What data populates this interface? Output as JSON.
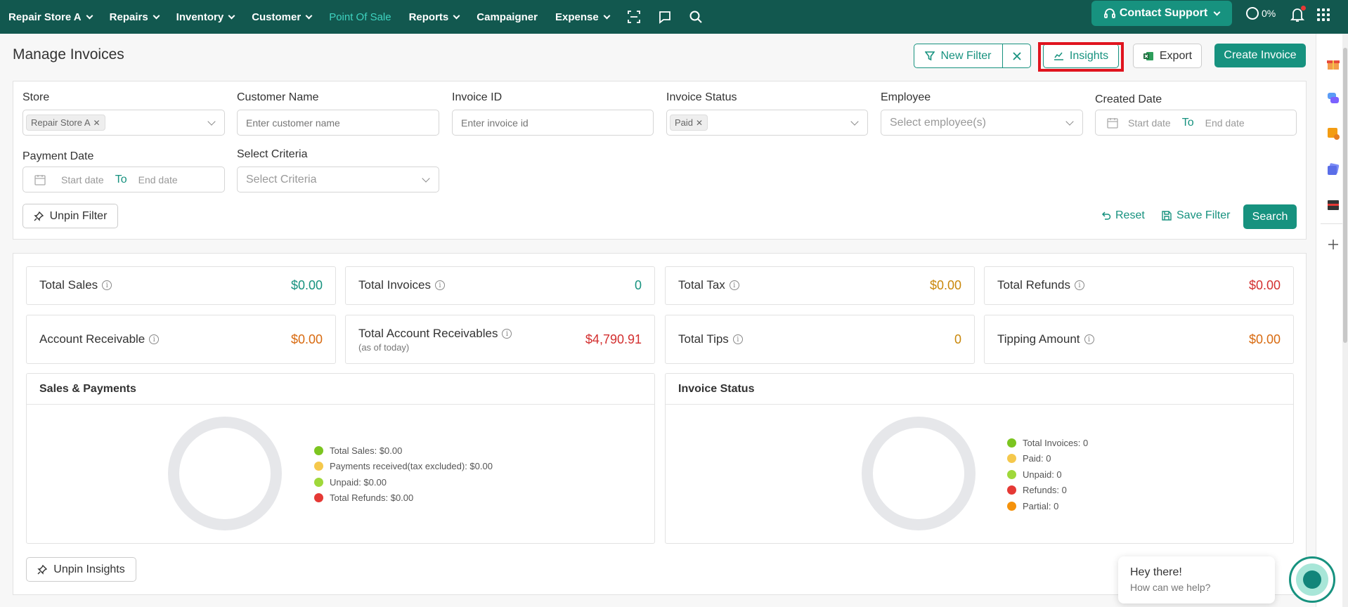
{
  "nav": {
    "store": "Repair Store A",
    "items": [
      "Repairs",
      "Inventory",
      "Customer",
      "Point Of Sale",
      "Reports",
      "Campaigner",
      "Expense"
    ],
    "support": "Contact Support",
    "progress": "0%"
  },
  "header": {
    "title": "Manage Invoices",
    "new_filter": "New Filter",
    "insights": "Insights",
    "export": "Export",
    "create_invoice": "Create Invoice"
  },
  "filters": {
    "store_label": "Store",
    "store_chip": "Repair Store A",
    "customer_label": "Customer Name",
    "customer_placeholder": "Enter customer name",
    "invoice_label": "Invoice ID",
    "invoice_placeholder": "Enter invoice id",
    "status_label": "Invoice Status",
    "status_chip": "Paid",
    "employee_label": "Employee",
    "employee_placeholder": "Select employee(s)",
    "created_label": "Created Date",
    "payment_label": "Payment Date",
    "start_date": "Start date",
    "to": "To",
    "end_date": "End date",
    "criteria_label": "Select Criteria",
    "criteria_placeholder": "Select Criteria",
    "unpin_filter": "Unpin Filter",
    "reset": "Reset",
    "save_filter": "Save Filter",
    "search": "Search"
  },
  "stats": {
    "total_sales_label": "Total Sales",
    "total_sales": "$0.00",
    "total_invoices_label": "Total Invoices",
    "total_invoices": "0",
    "total_tax_label": "Total Tax",
    "total_tax": "$0.00",
    "total_refunds_label": "Total Refunds",
    "total_refunds": "$0.00",
    "ar_label": "Account Receivable",
    "ar": "$0.00",
    "total_ar_label": "Total Account Receivables",
    "total_ar_sub": "(as of today)",
    "total_ar": "$4,790.91",
    "tips_label": "Total Tips",
    "tips": "0",
    "tipping_label": "Tipping Amount",
    "tipping": "$0.00"
  },
  "sales_chart": {
    "title": "Sales & Payments",
    "legend": [
      "Total Sales: $0.00",
      "Payments received(tax excluded): $0.00",
      "Unpaid: $0.00",
      "Total Refunds: $0.00"
    ],
    "colors": [
      "#7cc520",
      "#f5c84c",
      "#9fd83a",
      "#e53935"
    ]
  },
  "status_chart": {
    "title": "Invoice Status",
    "legend": [
      "Total Invoices: 0",
      "Paid: 0",
      "Unpaid: 0",
      "Refunds: 0",
      "Partial: 0"
    ],
    "colors": [
      "#7cc520",
      "#f5c84c",
      "#9fd83a",
      "#e53935",
      "#f5920b"
    ]
  },
  "unpin_insights": "Unpin Insights",
  "chat": {
    "greeting": "Hey there!",
    "prompt": "How can we help?"
  },
  "colors": {
    "primary": "#17927f",
    "nav_bg": "#12584f",
    "green_val": "#17927f",
    "orange_val": "#c9870a",
    "red_val": "#d32f2f"
  }
}
